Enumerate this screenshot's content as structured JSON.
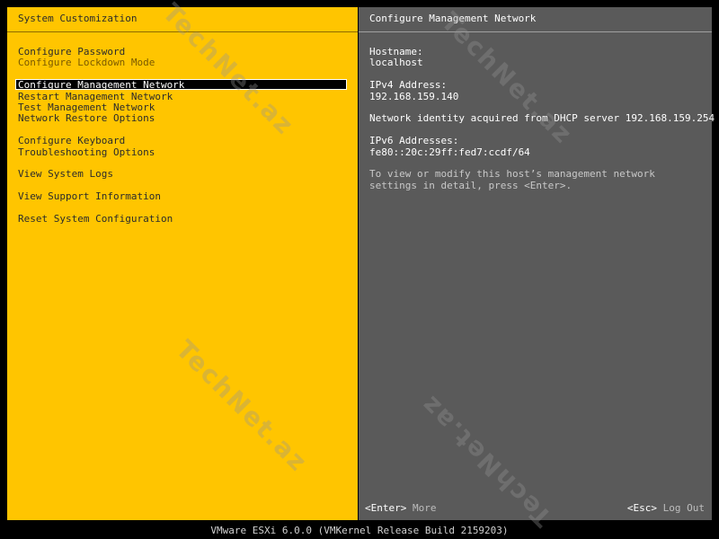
{
  "left_pane": {
    "title": "System Customization",
    "menu": [
      {
        "label": "Configure Password",
        "state": "normal",
        "group_start": false
      },
      {
        "label": "Configure Lockdown Mode",
        "state": "disabled",
        "group_start": false
      },
      {
        "label": "Configure Management Network",
        "state": "selected",
        "group_start": true
      },
      {
        "label": "Restart Management Network",
        "state": "normal",
        "group_start": false
      },
      {
        "label": "Test Management Network",
        "state": "normal",
        "group_start": false
      },
      {
        "label": "Network Restore Options",
        "state": "normal",
        "group_start": false
      },
      {
        "label": "Configure Keyboard",
        "state": "normal",
        "group_start": true
      },
      {
        "label": "Troubleshooting Options",
        "state": "normal",
        "group_start": false
      },
      {
        "label": "View System Logs",
        "state": "normal",
        "group_start": true
      },
      {
        "label": "View Support Information",
        "state": "normal",
        "group_start": true
      },
      {
        "label": "Reset System Configuration",
        "state": "normal",
        "group_start": true
      }
    ]
  },
  "right_pane": {
    "title": "Configure Management Network",
    "hostname_label": "Hostname:",
    "hostname_value": "localhost",
    "ipv4_label": "IPv4 Address:",
    "ipv4_value": "192.168.159.140",
    "dhcp_note": "Network identity acquired from DHCP server 192.168.159.254",
    "ipv6_label": "IPv6 Addresses:",
    "ipv6_value": "fe80::20c:29ff:fed7:ccdf/64",
    "hint": "To view or modify this host’s management network settings in detail, press <Enter>."
  },
  "footer": {
    "enter_key": "<Enter>",
    "enter_action": "More",
    "esc_key": "<Esc>",
    "esc_action": "Log Out"
  },
  "statusbar": {
    "text": "VMware ESXi 6.0.0 (VMKernel Release Build 2159203)"
  },
  "watermark": {
    "text": "TechNet.az"
  },
  "colors": {
    "left_pane_bg": "#ffc500",
    "right_pane_bg": "#5a5a5a",
    "screen_bg": "#000000"
  }
}
